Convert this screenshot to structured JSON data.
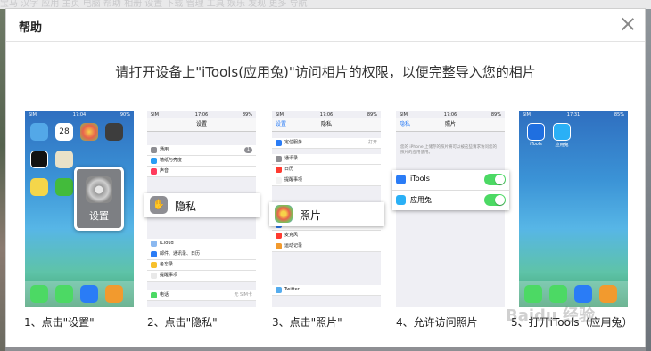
{
  "background_strip": "宝马 汉字 应用 主页 电脑 帮助 相册 设置 下载 管理 工具 娱乐 发现 更多 导航",
  "dialog": {
    "title": "帮助",
    "instruction": "请打开设备上\"iTools(应用兔)\"访问相片的权限，以便完整导入您的相片"
  },
  "steps": [
    {
      "caption": "1、点击\"设置\"",
      "popup_label": "设置",
      "status": {
        "carrier": "SIM",
        "time": "17:04",
        "battery": "90%"
      },
      "apps": [
        "日历 28",
        "照片",
        "相机",
        "时钟",
        "地图",
        "天气",
        "备忘录",
        "微信",
        "设置"
      ]
    },
    {
      "caption": "2、点击\"隐私\"",
      "popup_label": "隐私",
      "status": {
        "carrier": "SIM",
        "time": "17:06",
        "battery": "89%"
      },
      "nav_title": "设置",
      "rows": [
        {
          "label": "通用",
          "badge": "1"
        },
        {
          "label": "墙纸与亮度"
        },
        {
          "label": "声音"
        },
        {
          "label": "隐私"
        },
        {
          "label": "iCloud"
        },
        {
          "label": "邮件、通讯录、日历"
        },
        {
          "label": "备忘录"
        },
        {
          "label": "提醒事项"
        },
        {
          "label": "电话",
          "right": "无 SIM卡"
        }
      ]
    },
    {
      "caption": "3、点击\"照片\"",
      "popup_label": "照片",
      "status": {
        "carrier": "SIM",
        "time": "17:06",
        "battery": "89%"
      },
      "nav_back": "设置",
      "nav_title": "隐私",
      "rows": [
        {
          "label": "定位服务",
          "right": "打开"
        },
        {
          "label": "通讯录"
        },
        {
          "label": "日历"
        },
        {
          "label": "提醒事项"
        },
        {
          "label": "照片"
        },
        {
          "label": "蓝牙共享"
        },
        {
          "label": "麦克风"
        },
        {
          "label": "运动记录"
        },
        {
          "label": "Twitter"
        }
      ]
    },
    {
      "caption": "4、允许访问照片",
      "status": {
        "carrier": "SIM",
        "time": "17:06",
        "battery": "89%"
      },
      "nav_back": "隐私",
      "nav_title": "照片",
      "note": "您的 iPhone 上储存的照片将可以被这些请求访问您的照片的应用使用。",
      "apps": [
        {
          "name": "iTools",
          "enabled": true
        },
        {
          "name": "应用兔",
          "enabled": true
        }
      ]
    },
    {
      "caption": "5、打开iTools（应用兔）",
      "status": {
        "carrier": "SIM",
        "time": "17:31",
        "battery": "85%"
      },
      "apps": [
        "iTools",
        "应用兔"
      ]
    }
  ],
  "watermark": "Baidu 经验",
  "colors": {
    "ios_blue": "#2a7cf6",
    "toggle_green": "#4cd964",
    "settings_bg": "#efeff4"
  }
}
